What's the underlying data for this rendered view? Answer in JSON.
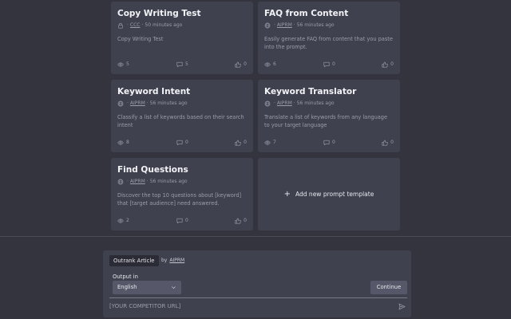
{
  "cards": [
    {
      "title": "Copy Writing Test",
      "visibility_icon": "lock-icon",
      "author": "CCC",
      "time": "50 minutes ago",
      "description": "Copy Writing Test",
      "views": "5",
      "comments": "5",
      "likes": "0"
    },
    {
      "title": "FAQ from Content",
      "visibility_icon": "globe-icon",
      "author": "AIPRM",
      "time": "56 minutes ago",
      "description": "Easily generate FAQ from content that you paste into the prompt.",
      "views": "6",
      "comments": "0",
      "likes": "0"
    },
    {
      "title": "Keyword Intent",
      "visibility_icon": "globe-icon",
      "author": "AIPRM",
      "time": "56 minutes ago",
      "description": "Classify a list of keywords based on their search intent",
      "views": "8",
      "comments": "0",
      "likes": "0"
    },
    {
      "title": "Keyword Translator",
      "visibility_icon": "globe-icon",
      "author": "AIPRM",
      "time": "56 minutes ago",
      "description": "Translate a list of keywords from any language to your target language",
      "views": "7",
      "comments": "0",
      "likes": "0"
    },
    {
      "title": "Find Questions",
      "visibility_icon": "globe-icon",
      "author": "AIPRM",
      "time": "56 minutes ago",
      "description": "Discover the top 10 questions about [keyword] that [target audience] need answered.",
      "views": "2",
      "comments": "0",
      "likes": "0"
    }
  ],
  "add_card": {
    "label": "Add new prompt template",
    "icon": "plus-icon"
  },
  "panel": {
    "selected_template": "Outrank Article",
    "by_label": "by",
    "author": "AIPRM",
    "output_label": "Output in",
    "language": "English",
    "continue_label": "Continue",
    "url_placeholder": "[YOUR COMPETITOR URL]",
    "send_icon": "send-icon"
  },
  "colors": {
    "background": "#33343e",
    "card": "#40414f",
    "control": "#565869"
  }
}
